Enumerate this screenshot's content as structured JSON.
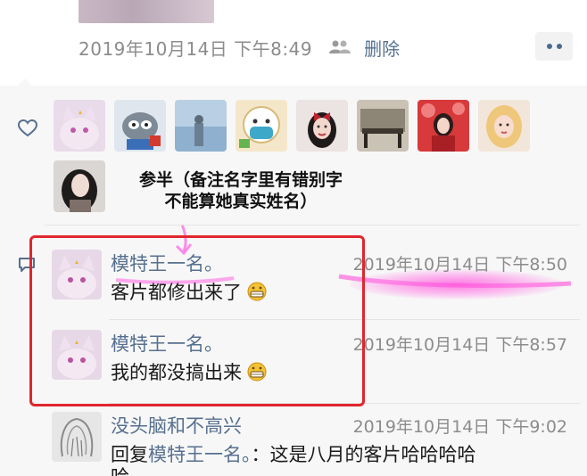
{
  "post": {
    "timestamp": "2019年10月14日 下午8:49",
    "delete_label": "删除"
  },
  "likes": {
    "icon": "heart-icon",
    "avatars": [
      {
        "name": "white-cat"
      },
      {
        "name": "cartoon-raccoon"
      },
      {
        "name": "sea-view"
      },
      {
        "name": "masked-cartoon"
      },
      {
        "name": "girl-with-bow"
      },
      {
        "name": "room-photo"
      },
      {
        "name": "red-outfit-girl"
      },
      {
        "name": "blonde-girl"
      },
      {
        "name": "portrait-girl"
      }
    ],
    "last_liker_name": "参半（备注名字里有错别字",
    "annotation_line2": "不能算她真实姓名）"
  },
  "comments": [
    {
      "name": "模特王一名。",
      "time": "2019年10月14日 下午8:50",
      "text": "客片都修出来了",
      "emoji": "grinning-face"
    },
    {
      "name": "模特王一名。",
      "time": "2019年10月14日 下午8:57",
      "text": "我的都没搞出来",
      "emoji": "grinning-face"
    },
    {
      "name": "没头脑和不高兴",
      "time": "2019年10月14日 下午9:02",
      "reply_prefix": "回复",
      "reply_target": "模特王一名。",
      "reply_text": "：这是八月的客片哈哈哈哈",
      "overflow_text": "哈"
    }
  ],
  "colors": {
    "link": "#56708f",
    "meta": "#8c8c8c",
    "highlight_border": "#e0262d",
    "highlight_glow": "#ff50dc"
  }
}
